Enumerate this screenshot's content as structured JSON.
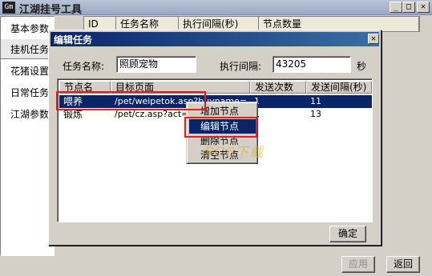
{
  "window": {
    "title": "江湖挂号工具",
    "icon_text": "Gm",
    "controls": {
      "minimize": "_",
      "maximize": "□",
      "close": "✕"
    }
  },
  "sidebar": {
    "items": [
      {
        "label": "基本参数"
      },
      {
        "label": "挂机任务"
      },
      {
        "label": "花猪设置"
      },
      {
        "label": "日常任务"
      },
      {
        "label": "江湖参数"
      }
    ]
  },
  "background_table": {
    "columns": [
      "ID",
      "任务名称",
      "执行间隔(秒)",
      "节点数量"
    ]
  },
  "main_buttons": {
    "apply": "应用",
    "return": "返回"
  },
  "dialog": {
    "title": "编辑任务",
    "close": "✕",
    "task_name_label": "任务名称:",
    "task_name_value": "照顾宠物",
    "interval_label": "执行间隔:",
    "interval_value": "43205",
    "interval_unit": "秒",
    "list": {
      "columns": [
        "节点名",
        "目标页面",
        "发送次数",
        "发送间隔(秒)"
      ],
      "rows": [
        {
          "name": "喂养",
          "page": "/pet/weipetok.asp?buyname=",
          "count": "1",
          "interval": "11"
        },
        {
          "name": "锻炼",
          "page": "/pet/cz.asp?act=p",
          "count": "1",
          "interval": "13"
        }
      ]
    },
    "ok": "确定"
  },
  "context_menu": {
    "items": [
      "增加节点",
      "编辑节点",
      "删除节点",
      "清空节点"
    ],
    "highlighted_index": 1
  },
  "watermark": "PC6下载",
  "colors": {
    "highlight_red": "#e02020",
    "selection_blue": "#0a246a"
  }
}
